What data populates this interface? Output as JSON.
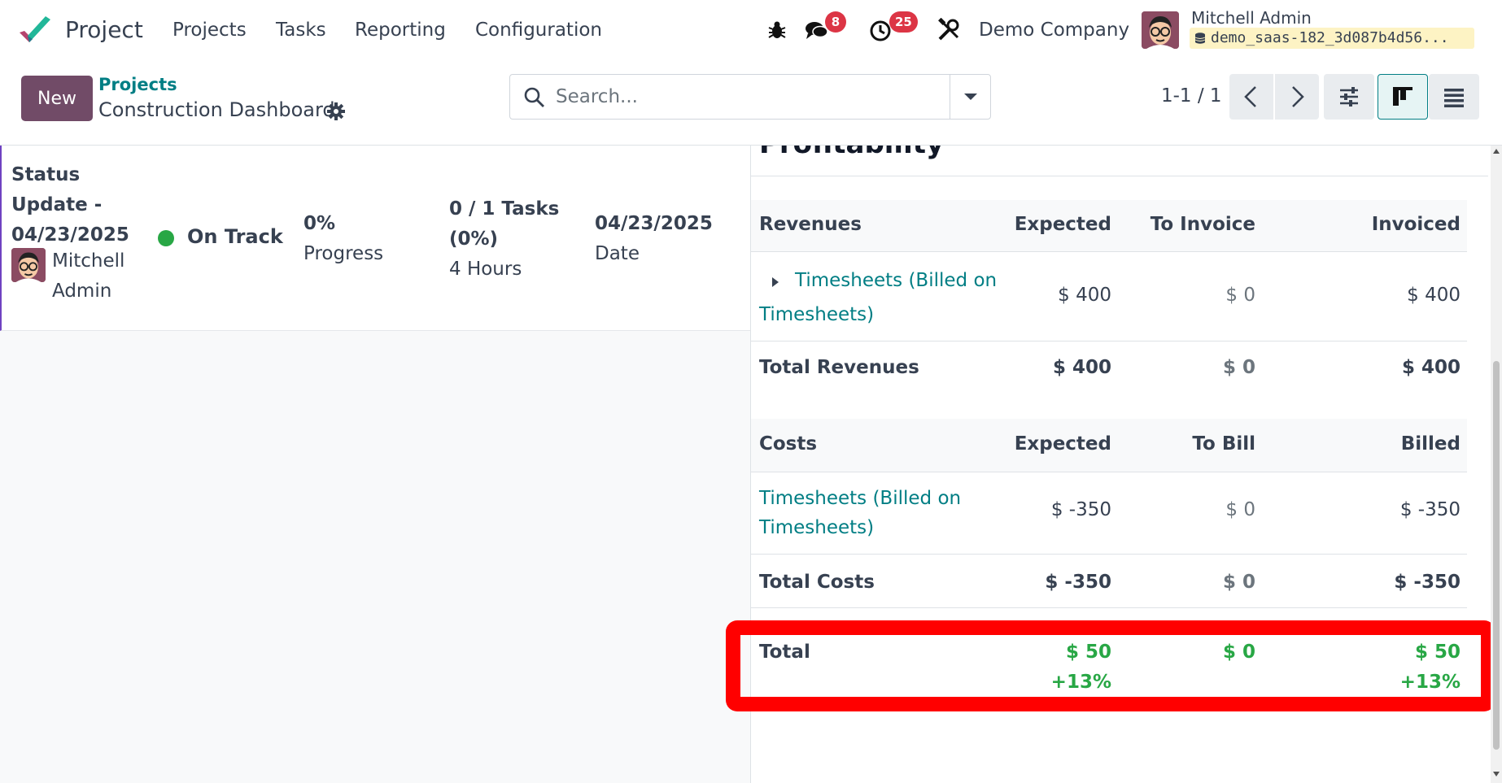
{
  "navbar": {
    "app_name": "Project",
    "menu": [
      "Projects",
      "Tasks",
      "Reporting",
      "Configuration"
    ],
    "messages_count": "8",
    "activities_count": "25",
    "company": "Demo Company",
    "user_name": "Mitchell Admin",
    "database": "demo_saas-182_3d087b4d56..."
  },
  "control": {
    "new_label": "New",
    "breadcrumb_parent": "Projects",
    "breadcrumb_current": "Construction Dashboard",
    "search_placeholder": "Search...",
    "pager": "1-1 / 1"
  },
  "status_update": {
    "title": "Status Update - 04/23/2025",
    "author": "Mitchell Admin",
    "status": "On Track",
    "status_color": "#28a745",
    "progress_value": "0%",
    "progress_label": "Progress",
    "tasks_value": "0 / 1 Tasks (0%)",
    "hours": "4 Hours",
    "date_value": "04/23/2025",
    "date_label": "Date"
  },
  "profitability": {
    "title": "Profitability",
    "revenues": {
      "header": [
        "Revenues",
        "Expected",
        "To Invoice",
        "Invoiced"
      ],
      "line": {
        "label": "Timesheets (Billed on Timesheets)",
        "expected": "$ 400",
        "to_invoice": "$ 0",
        "invoiced": "$ 400"
      },
      "total": {
        "label": "Total Revenues",
        "expected": "$ 400",
        "to_invoice": "$ 0",
        "invoiced": "$ 400"
      }
    },
    "costs": {
      "header": [
        "Costs",
        "Expected",
        "To Bill",
        "Billed"
      ],
      "line": {
        "label": "Timesheets (Billed on Timesheets)",
        "expected": "$ -350",
        "to_bill": "$ 0",
        "billed": "$ -350"
      },
      "total": {
        "label": "Total Costs",
        "expected": "$ -350",
        "to_bill": "$ 0",
        "billed": "$ -350"
      }
    },
    "grand_total": {
      "label": "Total",
      "expected": "$ 50",
      "expected_pct": "+13%",
      "middle": "$ 0",
      "last": "$ 50",
      "last_pct": "+13%"
    }
  }
}
